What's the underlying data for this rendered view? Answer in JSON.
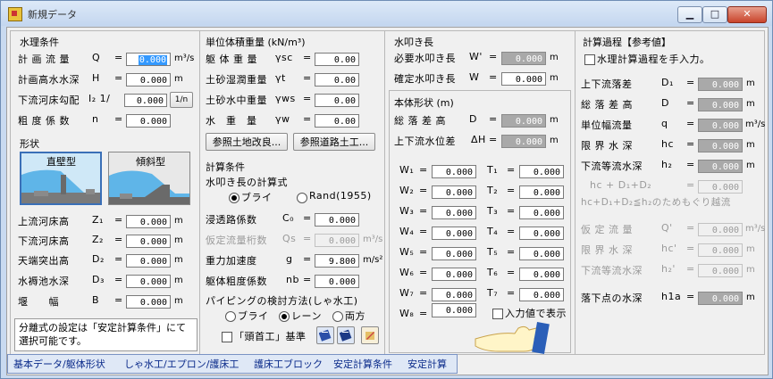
{
  "window": {
    "title": "新規データ",
    "min": "▁",
    "max": "□",
    "close": "✕"
  },
  "panel1": {
    "section_hydro": "水理条件",
    "rows": [
      {
        "label": "計 画 流 量",
        "sym": "Q",
        "value": "0.000",
        "unit": "m³/s"
      },
      {
        "label": "計画高水水深",
        "sym": "H",
        "value": "0.000",
        "unit": "m"
      },
      {
        "label": "下流河床勾配",
        "sym": "I₂ 1/",
        "value": "0.000",
        "unit": "1/n"
      },
      {
        "label": "粗 度 係 数",
        "sym": "n",
        "value": "0.000",
        "unit": ""
      }
    ],
    "section_shape": "形状",
    "type_vertical": "直壁型",
    "type_slope": "傾斜型",
    "rows2": [
      {
        "label": "上流河床高",
        "sym": "Z₁",
        "value": "0.000",
        "unit": "m"
      },
      {
        "label": "下流河床高",
        "sym": "Z₂",
        "value": "0.000",
        "unit": "m"
      },
      {
        "label": "天端突出高",
        "sym": "D₂",
        "value": "0.000",
        "unit": "m"
      },
      {
        "label": "水褥池水深",
        "sym": "D₃",
        "value": "0.000",
        "unit": "m"
      },
      {
        "label": "堰　　幅",
        "sym": "B",
        "value": "0.000",
        "unit": "m"
      }
    ],
    "note": "分離式の設定は「安定計算条件」にて選択可能です。"
  },
  "panel2": {
    "section_weight": "単位体積重量 (kN/m³)",
    "rows": [
      {
        "label": "躯 体 重 量",
        "sym": "γsc",
        "value": "0.00"
      },
      {
        "label": "土砂湿潤重量",
        "sym": "γt",
        "value": "0.00"
      },
      {
        "label": "土砂水中重量",
        "sym": "γws",
        "value": "0.00"
      },
      {
        "label": "水　重　量",
        "sym": "γw",
        "value": "0.00"
      }
    ],
    "btn_ref_soil": "参照土地改良...",
    "btn_ref_road": "参照道路土工...",
    "section_calc": "計算条件",
    "apron_method_label": "水叩き長の計算式",
    "radio_bligh": "ブライ",
    "radio_rand": "Rand(1955)",
    "rows2": [
      {
        "label": "浸透路係数",
        "sym": "C₀",
        "value": "0.000",
        "unit": "",
        "disabled": false
      },
      {
        "label": "仮定流量桁数",
        "sym": "Qs",
        "value": "0.000",
        "unit": "m³/s",
        "disabled": true
      },
      {
        "label": "重力加速度",
        "sym": "g",
        "value": "9.800",
        "unit": "m/s²",
        "disabled": false
      },
      {
        "label": "躯体粗度係数",
        "sym": "nb",
        "value": "0.000",
        "unit": "",
        "disabled": false
      }
    ],
    "piping_label": "パイピングの検討方法(しゃ水工)",
    "radio_bligh2": "ブライ",
    "radio_lane": "レーン",
    "radio_both": "両方",
    "check_head": "「頭首工」基準"
  },
  "panel3": {
    "section_apron": "水叩き長",
    "rows": [
      {
        "label": "必要水叩き長",
        "sym": "W'",
        "value": "0.000",
        "unit": "m",
        "disabled": true
      },
      {
        "label": "確定水叩き長",
        "sym": "W",
        "value": "0.000",
        "unit": "m",
        "disabled": false
      }
    ],
    "section_body": "本体形状 (m)",
    "rows2": [
      {
        "label": "総 落 差 高",
        "sym": "D",
        "value": "0.000",
        "unit": "m"
      },
      {
        "label": "上下流水位差",
        "sym": "ΔH",
        "value": "0.000",
        "unit": "m"
      }
    ],
    "w": [
      "0.000",
      "0.000",
      "0.000",
      "0.000",
      "0.000",
      "0.000",
      "0.000",
      "0.000"
    ],
    "t": [
      "0.000",
      "0.000",
      "0.000",
      "0.000",
      "0.000",
      "0.000",
      "0.000"
    ],
    "w_labels": [
      "W₁",
      "W₂",
      "W₃",
      "W₄",
      "W₅",
      "W₆",
      "W₇",
      "W₈"
    ],
    "t_labels": [
      "T₁",
      "T₂",
      "T₃",
      "T₄",
      "T₅",
      "T₆",
      "T₇"
    ],
    "check_show_input": "入力値で表示"
  },
  "panel4": {
    "section": "計算過程【参考値】",
    "check_manual": "水理計算過程を手入力。",
    "rows": [
      {
        "label": "上下流落差",
        "sym": "D₁",
        "value": "0.000",
        "unit": "m"
      },
      {
        "label": "総 落 差 高",
        "sym": "D",
        "value": "0.000",
        "unit": "m"
      },
      {
        "label": "単位幅流量",
        "sym": "q",
        "value": "0.000",
        "unit": "m³/s"
      },
      {
        "label": "限 界 水 深",
        "sym": "hc",
        "value": "0.000",
        "unit": "m"
      },
      {
        "label": "下流等流水深",
        "sym": "h₂",
        "value": "0.000",
        "unit": "m"
      }
    ],
    "formula1": "hc + D₁+D₂",
    "formula1_value": "0.000",
    "formula2": "hc+D₁+D₂≦h₂のためもぐり越流",
    "rows2": [
      {
        "label": "仮 定 流 量",
        "sym": "Q'",
        "value": "0.000",
        "unit": "m³/s"
      },
      {
        "label": "限 界 水 深",
        "sym": "hc'",
        "value": "0.000",
        "unit": "m"
      },
      {
        "label": "下流等流水深",
        "sym": "h₂'",
        "value": "0.000",
        "unit": "m"
      }
    ],
    "fall_label": "落下点の水深",
    "fall_sym": "h1a",
    "fall_value": "0.000",
    "fall_unit": "m"
  },
  "tabs": [
    "基本データ/躯体形状",
    "しゃ水工/エプロン/護床工",
    "護床工ブロック",
    "安定計算条件",
    "安定計算"
  ],
  "colors": {
    "titlebar": "#c3d6ef",
    "selected": "#3399ff",
    "disabled_field": "#a9a9a9",
    "close": "#c9442b"
  }
}
